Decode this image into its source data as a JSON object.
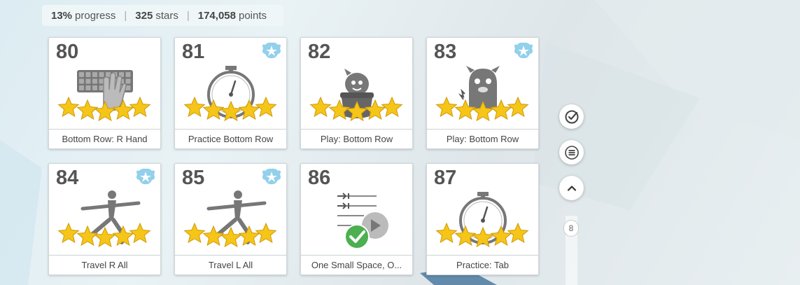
{
  "stats": {
    "progress_value": "13%",
    "progress_label": "progress",
    "stars_value": "325",
    "stars_label": "stars",
    "points_value": "174,058",
    "points_label": "points",
    "separator": "|"
  },
  "lessons": [
    {
      "number": "80",
      "title": "Bottom Row: R Hand",
      "stars": 5,
      "badge": false,
      "art": "keyboard-hand-icon"
    },
    {
      "number": "81",
      "title": "Practice Bottom Row",
      "stars": 5,
      "badge": true,
      "art": "stopwatch-icon"
    },
    {
      "number": "82",
      "title": "Play: Bottom Row",
      "stars": 5,
      "badge": false,
      "art": "creature-in-pot-icon"
    },
    {
      "number": "83",
      "title": "Play: Bottom Row",
      "stars": 5,
      "badge": true,
      "art": "monster-icon"
    },
    {
      "number": "84",
      "title": "Travel R All",
      "stars": 5,
      "badge": true,
      "art": "yoga-pose-icon"
    },
    {
      "number": "85",
      "title": "Travel L All",
      "stars": 5,
      "badge": true,
      "art": "yoga-pose-icon"
    },
    {
      "number": "86",
      "title": "One Small Space, O...",
      "stars": 0,
      "badge": false,
      "art": "video-complete-icon"
    },
    {
      "number": "87",
      "title": "Practice: Tab",
      "stars": 5,
      "badge": false,
      "art": "stopwatch-icon"
    }
  ],
  "side_controls": {
    "check_icon": "check-circle-icon",
    "menu_icon": "hamburger-menu-icon",
    "up_icon": "chevron-up-icon",
    "page_number": "8"
  },
  "colors": {
    "star": "#f5c518",
    "badge": "#7fc8e8",
    "check": "#4caf50",
    "art_gray": "#777777"
  }
}
